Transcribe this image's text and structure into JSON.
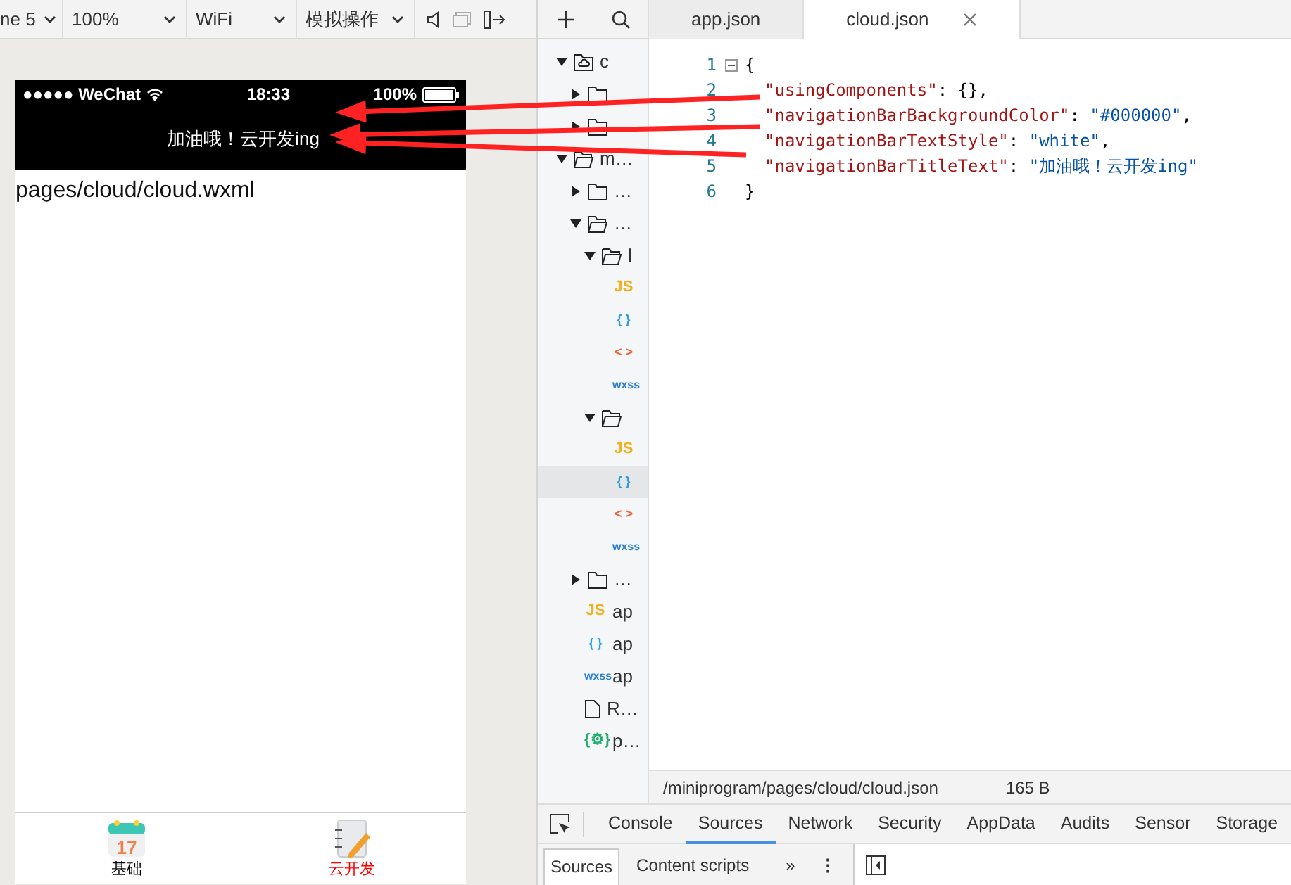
{
  "simulator_toolbar": {
    "device": "ne 5",
    "zoom": "100%",
    "network": "WiFi",
    "operations": "模拟操作"
  },
  "phone": {
    "status_bar": {
      "carrier": "●●●●● WeChat",
      "time": "18:33",
      "battery": "100%"
    },
    "nav_bar": {
      "title": "加油哦！云开发ing"
    },
    "content": "pages/cloud/cloud.wxml",
    "tab_bar": [
      {
        "label": "基础",
        "kind": "calendar",
        "icon_text": "17",
        "selected": false
      },
      {
        "label": "云开发",
        "kind": "notebook",
        "selected": true
      }
    ]
  },
  "file_tree": [
    {
      "kind": "cloud-folder",
      "label": "c",
      "expanded": true,
      "children": [
        {
          "kind": "folder",
          "expanded": false
        },
        {
          "kind": "folder",
          "expanded": false
        }
      ]
    },
    {
      "kind": "folder",
      "label": "m…",
      "expanded": true,
      "children": [
        {
          "kind": "folder",
          "label": "…",
          "expanded": false
        },
        {
          "kind": "folder",
          "label": "…",
          "expanded": true,
          "children": [
            {
              "kind": "folder",
              "label": "l",
              "expanded": true,
              "children": [
                {
                  "kind": "js",
                  "icon_text": "JS",
                  "selected": false
                },
                {
                  "kind": "json",
                  "icon_text": "{ }",
                  "selected": false
                },
                {
                  "kind": "wxml",
                  "icon_text": "< >",
                  "selected": false
                },
                {
                  "kind": "wxss",
                  "icon_text": "wxss",
                  "selected": false
                }
              ]
            },
            {
              "kind": "folder",
              "expanded": true,
              "children": [
                {
                  "kind": "js",
                  "icon_text": "JS",
                  "selected": false
                },
                {
                  "kind": "json",
                  "icon_text": "{ }",
                  "selected": true
                },
                {
                  "kind": "wxml",
                  "icon_text": "< >",
                  "selected": false
                },
                {
                  "kind": "wxss",
                  "icon_text": "wxss",
                  "selected": false
                }
              ]
            }
          ]
        },
        {
          "kind": "folder",
          "label": "…",
          "expanded": false
        },
        {
          "kind": "js",
          "icon_text": "JS",
          "label": "ap",
          "selected": false
        },
        {
          "kind": "json",
          "icon_text": "{ }",
          "label": "ap",
          "selected": false
        },
        {
          "kind": "wxss",
          "icon_text": "wxss",
          "label": "ap",
          "selected": false
        },
        {
          "kind": "file",
          "label": "R…",
          "selected": false
        },
        {
          "kind": "config",
          "icon_text": "{⚙}",
          "label": "p…",
          "selected": false
        }
      ]
    }
  ],
  "editor_tabs": [
    {
      "label": "app.json",
      "selected": false,
      "closable": false
    },
    {
      "label": "cloud.json",
      "selected": true,
      "closable": true
    }
  ],
  "code_lines": [
    {
      "number": "1",
      "foldable": true,
      "tokens": [
        {
          "kind": "punct",
          "text": "{"
        }
      ]
    },
    {
      "number": "2",
      "foldable": false,
      "tokens": [
        {
          "kind": "key",
          "text": "\"usingComponents\""
        },
        {
          "kind": "punct",
          "text": ": {},"
        }
      ]
    },
    {
      "number": "3",
      "foldable": false,
      "tokens": [
        {
          "kind": "key",
          "text": "\"navigationBarBackgroundColor\""
        },
        {
          "kind": "punct",
          "text": ": "
        },
        {
          "kind": "string",
          "text": "\"#000000\""
        },
        {
          "kind": "punct",
          "text": ","
        }
      ]
    },
    {
      "number": "4",
      "foldable": false,
      "tokens": [
        {
          "kind": "key",
          "text": "\"navigationBarTextStyle\""
        },
        {
          "kind": "punct",
          "text": ": "
        },
        {
          "kind": "string",
          "text": "\"white\""
        },
        {
          "kind": "punct",
          "text": ","
        }
      ]
    },
    {
      "number": "5",
      "foldable": false,
      "tokens": [
        {
          "kind": "key",
          "text": "\"navigationBarTitleText\""
        },
        {
          "kind": "punct",
          "text": ": "
        },
        {
          "kind": "string",
          "text": "\"加油哦！云开发ing\""
        }
      ]
    },
    {
      "number": "6",
      "foldable": false,
      "tokens": [
        {
          "kind": "punct",
          "text": "}"
        }
      ]
    }
  ],
  "status_bar": {
    "path": "/miniprogram/pages/cloud/cloud.json",
    "size": "165 B"
  },
  "devtools_tabs": [
    {
      "label": "Console",
      "selected": false
    },
    {
      "label": "Sources",
      "selected": true
    },
    {
      "label": "Network",
      "selected": false
    },
    {
      "label": "Security",
      "selected": false
    },
    {
      "label": "AppData",
      "selected": false
    },
    {
      "label": "Audits",
      "selected": false
    },
    {
      "label": "Sensor",
      "selected": false
    },
    {
      "label": "Storage",
      "selected": false
    }
  ],
  "sources_tabs": [
    {
      "label": "Sources",
      "selected": true
    },
    {
      "label": "Content scripts",
      "selected": false
    }
  ],
  "more_tabs": "»",
  "menu": "⋮"
}
